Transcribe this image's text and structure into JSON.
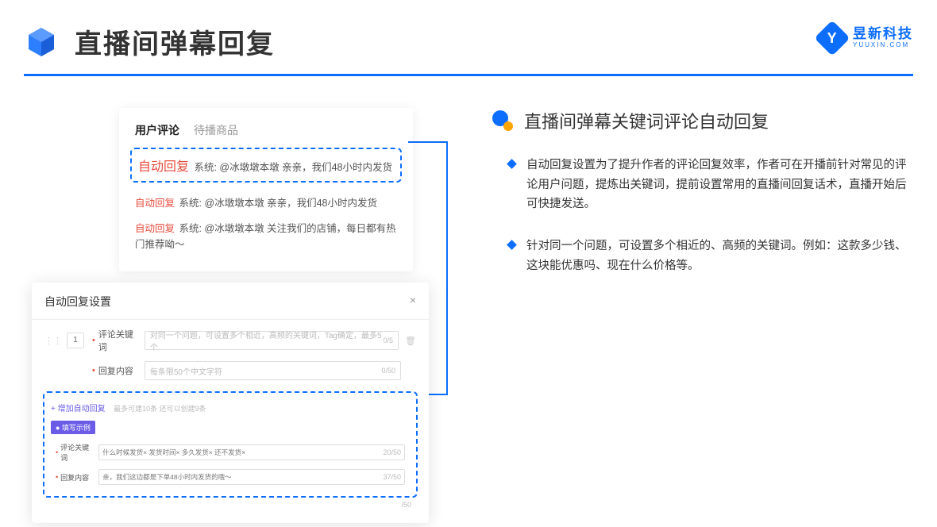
{
  "header": {
    "title": "直播间弹幕回复"
  },
  "brand": {
    "cn": "昱新科技",
    "en": "YUUXIN.COM"
  },
  "card1": {
    "tab1": "用户评论",
    "tab2": "待播商品",
    "highlight": {
      "tag": "自动回复",
      "text": "系统: @冰墩墩本墩 亲亲，我们48小时内发货"
    },
    "line2": {
      "tag": "自动回复",
      "text": "系统: @冰墩墩本墩 亲亲，我们48小时内发货"
    },
    "line3": {
      "tag": "自动回复",
      "text": "系统: @冰墩墩本墩 关注我们的店铺，每日都有热门推荐呦～"
    }
  },
  "card2": {
    "title": "自动回复设置",
    "close": "×",
    "num": "1",
    "row1": {
      "label": "评论关键词",
      "placeholder": "对同一个问题，可设置多个相近，高频的关键词，Tag确定，最多5个",
      "count": "0/5"
    },
    "row2": {
      "label": "回复内容",
      "placeholder": "每条限50个中文字符",
      "count": "0/50"
    },
    "addLink": "+ 增加自动回复",
    "addHint": "最多可建10条 还可以创建9条",
    "badge": "● 填写示例",
    "ex1": {
      "label": "评论关键词",
      "tags": "什么时候发货× 发货时间× 多久发货× 还不发货×",
      "count": "20/50"
    },
    "ex2": {
      "label": "回复内容",
      "text": "亲，我们这边都是下单48小时内发货的哦～",
      "count": "37/50"
    },
    "bottom": "/50"
  },
  "right": {
    "title": "直播间弹幕关键词评论自动回复",
    "b1": "自动回复设置为了提升作者的评论回复效率，作者可在开播前针对常见的评论用户问题，提炼出关键词，提前设置常用的直播间回复话术，直播开始后可快捷发送。",
    "b2": "针对同一个问题，可设置多个相近的、高频的关键词。例如：这款多少钱、这块能优惠吗、现在什么价格等。"
  }
}
